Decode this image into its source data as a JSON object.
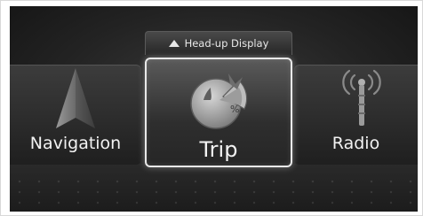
{
  "hud": {
    "label": "Head-up Display",
    "icon": "triangle-up-icon"
  },
  "menu": {
    "items": [
      {
        "label": "Navigation",
        "icon": "navigation-arrow-icon",
        "selected": false
      },
      {
        "label": "Trip",
        "icon": "trip-computer-icon",
        "selected": true
      },
      {
        "label": "Radio",
        "icon": "radio-antenna-icon",
        "selected": false
      }
    ],
    "trip_icon_text": "%"
  }
}
